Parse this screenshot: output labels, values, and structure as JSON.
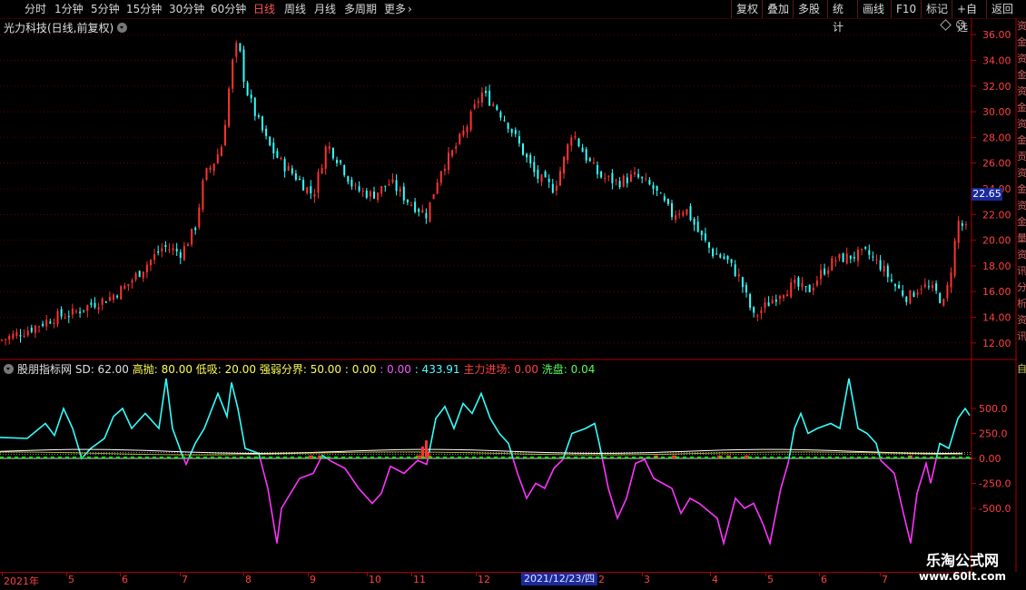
{
  "toolbar": {
    "periods": [
      "分时",
      "1分钟",
      "5分钟",
      "15分钟",
      "30分钟",
      "60分钟",
      "日线",
      "周线",
      "月线",
      "多周期",
      "更多"
    ],
    "active_period": "日线",
    "right_buttons": [
      "复权",
      "叠加",
      "多股",
      "统计",
      "画线",
      "F10",
      "标记",
      "+自选",
      "返回"
    ]
  },
  "title": "光力科技(日线,前复权)",
  "price_axis": {
    "labels": [
      "36.00",
      "34.00",
      "32.00",
      "30.00",
      "28.00",
      "26.00",
      "24.00",
      "22.00",
      "20.00",
      "18.00",
      "16.00",
      "14.00",
      "12.00"
    ],
    "current_price": "22.65"
  },
  "indicator": {
    "name": "股朋指标网",
    "sd_label": "SD: 62.00",
    "gaopao_label": "高抛: 80.00",
    "dixi_label": "低吸: 20.00",
    "qiangruo_label": "强弱分界: 50.00",
    "v1": ": 0.00",
    "v2": ": 0.00",
    "v3": ": 433.91",
    "zhuli_label": "主力进场: 0.00",
    "xipan_label": "洗盘: 0.04",
    "axis_labels": [
      "500.0",
      "250.0",
      "0.00",
      "-250.0",
      "-500.0"
    ]
  },
  "dates": {
    "labels": [
      "2021年",
      "5",
      "6",
      "7",
      "8",
      "9",
      "10",
      "11",
      "12",
      "2",
      "3",
      "4",
      "5",
      "6",
      "7"
    ],
    "cursor": "2021/12/23/四"
  },
  "right_strip": "资金资金资金资金贡资金资金量资讯分析资讯",
  "right_strip_bottom": "自",
  "watermark": {
    "line1": "乐淘公式网",
    "line2": "www.60lt.com"
  },
  "colors": {
    "up": "#ff3333",
    "down": "#33ffff",
    "magenta": "#ff33ff",
    "grid": "#a00000",
    "green": "#00ff00"
  },
  "chart_data": {
    "type": "candlestick",
    "y_range": [
      11,
      37
    ],
    "series_keypoints": [
      [
        0,
        12.2
      ],
      [
        30,
        13.0
      ],
      [
        60,
        14.0
      ],
      [
        80,
        14.3
      ],
      [
        100,
        15.0
      ],
      [
        120,
        15.5
      ],
      [
        140,
        16.5
      ],
      [
        160,
        18.0
      ],
      [
        180,
        19.5
      ],
      [
        200,
        19.0
      ],
      [
        215,
        21.0
      ],
      [
        225,
        25.0
      ],
      [
        235,
        26.0
      ],
      [
        245,
        27.5
      ],
      [
        255,
        33.5
      ],
      [
        262,
        35.5
      ],
      [
        270,
        32.0
      ],
      [
        280,
        30.0
      ],
      [
        295,
        27.5
      ],
      [
        310,
        26.0
      ],
      [
        325,
        25.0
      ],
      [
        345,
        23.5
      ],
      [
        360,
        27.5
      ],
      [
        375,
        26.0
      ],
      [
        390,
        24.0
      ],
      [
        410,
        23.5
      ],
      [
        430,
        24.5
      ],
      [
        450,
        23.0
      ],
      [
        470,
        22.0
      ],
      [
        485,
        25.5
      ],
      [
        500,
        27.0
      ],
      [
        515,
        29.0
      ],
      [
        530,
        31.5
      ],
      [
        545,
        30.5
      ],
      [
        560,
        29.0
      ],
      [
        575,
        27.0
      ],
      [
        590,
        25.0
      ],
      [
        610,
        24.0
      ],
      [
        620,
        26.0
      ],
      [
        630,
        28.5
      ],
      [
        645,
        26.5
      ],
      [
        660,
        25.0
      ],
      [
        680,
        24.5
      ],
      [
        700,
        25.0
      ],
      [
        720,
        24.0
      ],
      [
        740,
        22.0
      ],
      [
        755,
        22.5
      ],
      [
        770,
        20.5
      ],
      [
        785,
        19.0
      ],
      [
        800,
        18.5
      ],
      [
        815,
        17.0
      ],
      [
        830,
        14.0
      ],
      [
        845,
        15.0
      ],
      [
        860,
        16.0
      ],
      [
        875,
        16.5
      ],
      [
        890,
        16.0
      ],
      [
        905,
        17.5
      ],
      [
        920,
        18.5
      ],
      [
        935,
        18.7
      ],
      [
        955,
        19.0
      ],
      [
        970,
        18.0
      ],
      [
        985,
        16.5
      ],
      [
        1000,
        15.5
      ],
      [
        1015,
        16.5
      ],
      [
        1030,
        16.0
      ],
      [
        1040,
        15.0
      ],
      [
        1048,
        18.0
      ],
      [
        1055,
        21.5
      ],
      [
        1068,
        20.5
      ]
    ]
  }
}
